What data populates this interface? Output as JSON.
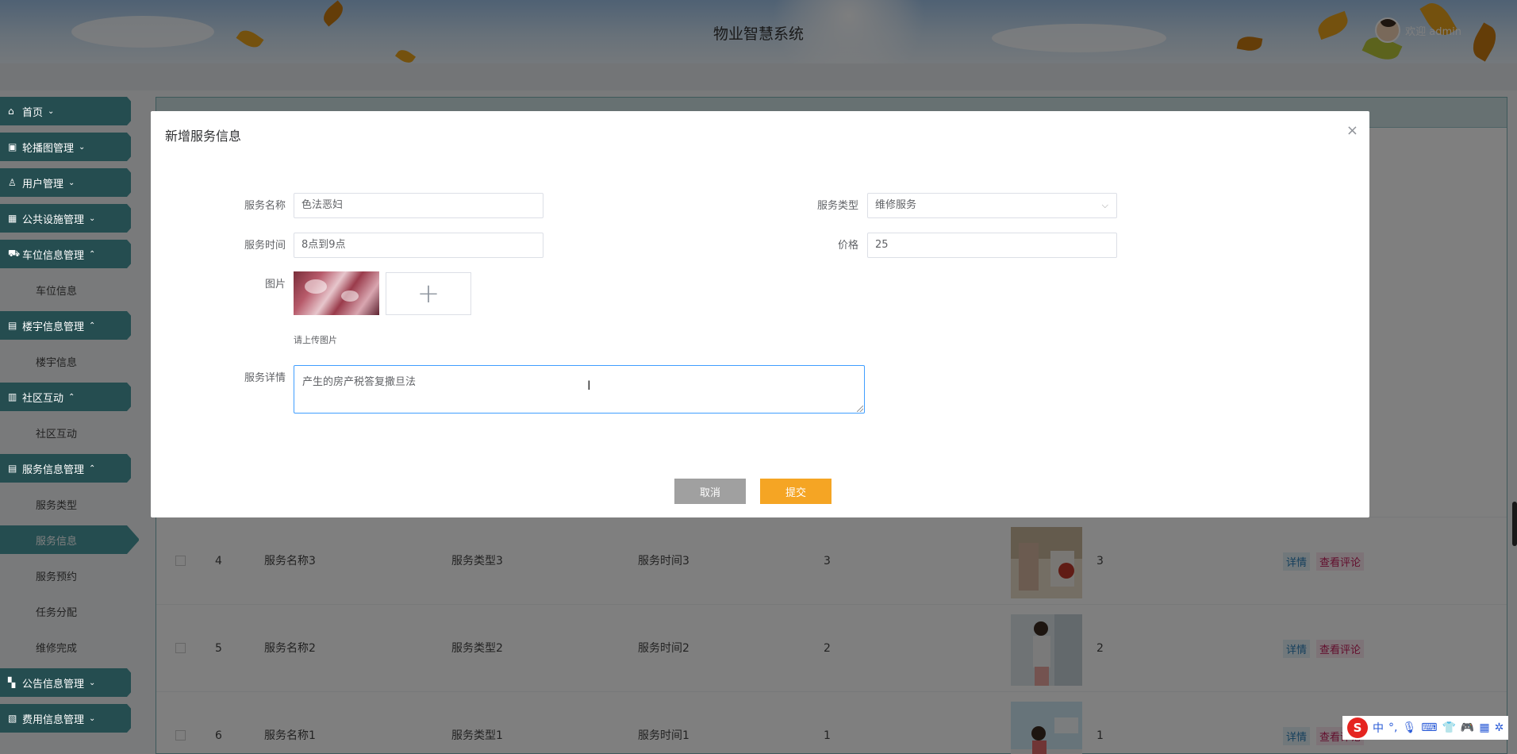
{
  "header": {
    "title": "物业智慧系统",
    "welcome": "欢迎 admin"
  },
  "sidebar": {
    "items": [
      {
        "label": "首页",
        "icon": "home-icon",
        "glyph": "⌂",
        "chev": "⌄",
        "type": "group"
      },
      {
        "label": "轮播图管理",
        "icon": "image-icon",
        "glyph": "▣",
        "chev": "⌄",
        "type": "group"
      },
      {
        "label": "用户管理",
        "icon": "user-icon",
        "glyph": "♙",
        "chev": "⌄",
        "type": "group"
      },
      {
        "label": "公共设施管理",
        "icon": "building-icon",
        "glyph": "▦",
        "chev": "⌄",
        "type": "group"
      },
      {
        "label": "车位信息管理",
        "icon": "car-icon",
        "glyph": "⛟",
        "chev": "⌃",
        "type": "group"
      },
      {
        "label": "车位信息",
        "type": "sub"
      },
      {
        "label": "楼宇信息管理",
        "icon": "book-icon",
        "glyph": "▤",
        "chev": "⌃",
        "type": "group"
      },
      {
        "label": "楼宇信息",
        "type": "sub"
      },
      {
        "label": "社区互动",
        "icon": "chart-icon",
        "glyph": "▥",
        "chev": "⌃",
        "type": "group"
      },
      {
        "label": "社区互动",
        "type": "sub"
      },
      {
        "label": "服务信息管理",
        "icon": "service-icon",
        "glyph": "▤",
        "chev": "⌃",
        "type": "group"
      },
      {
        "label": "服务类型",
        "type": "sub"
      },
      {
        "label": "服务信息",
        "type": "sub",
        "active": true
      },
      {
        "label": "服务预约",
        "type": "sub"
      },
      {
        "label": "任务分配",
        "type": "sub"
      },
      {
        "label": "维修完成",
        "type": "sub"
      },
      {
        "label": "公告信息管理",
        "icon": "grid-icon",
        "glyph": "▚",
        "chev": "⌄",
        "type": "group"
      },
      {
        "label": "费用信息管理",
        "icon": "money-icon",
        "glyph": "▧",
        "chev": "⌄",
        "type": "group"
      }
    ]
  },
  "table": {
    "rows": [
      {
        "index": "4",
        "name": "服务名称3",
        "type": "服务类型3",
        "time": "服务时间3",
        "price": "3",
        "stock": "3",
        "detail": "详情",
        "review": "查看评论"
      },
      {
        "index": "5",
        "name": "服务名称2",
        "type": "服务类型2",
        "time": "服务时间2",
        "price": "2",
        "stock": "2",
        "detail": "详情",
        "review": "查看评论"
      },
      {
        "index": "6",
        "name": "服务名称1",
        "type": "服务类型1",
        "time": "服务时间1",
        "price": "1",
        "stock": "1",
        "detail": "详情",
        "review": "查看评论"
      }
    ]
  },
  "dialog": {
    "title": "新增服务信息",
    "close": "×",
    "fields": {
      "name_label": "服务名称",
      "name_value": "色法恶妇",
      "type_label": "服务类型",
      "type_value": "维修服务",
      "time_label": "服务时间",
      "time_value": "8点到9点",
      "price_label": "价格",
      "price_value": "25",
      "image_label": "图片",
      "image_hint": "请上传图片",
      "image_add": "+",
      "detail_label": "服务详情",
      "detail_value": "产生的房产税答复撒旦法"
    },
    "cancel": "取消",
    "submit": "提交"
  },
  "ime": {
    "logo": "S",
    "mode": "中",
    "punct": "°,"
  }
}
